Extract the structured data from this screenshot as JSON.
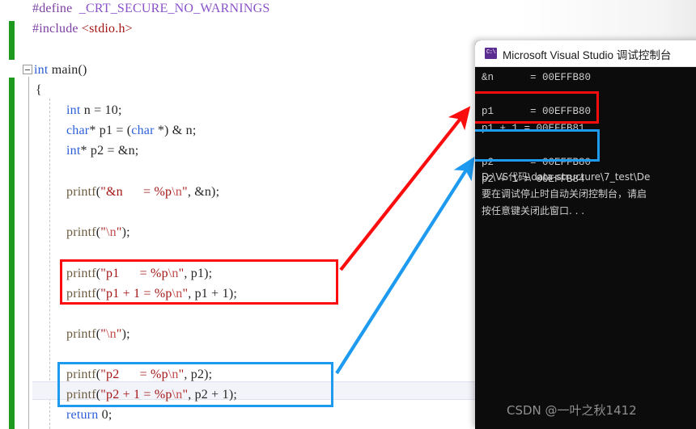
{
  "editor": {
    "code_lines": [
      {
        "indent": 0,
        "tokens": [
          {
            "t": "#define  ",
            "c": "k-pre"
          },
          {
            "t": "_CRT_SECURE_NO_WARNINGS",
            "c": "k-macro"
          }
        ]
      },
      {
        "indent": 0,
        "tokens": [
          {
            "t": "#include ",
            "c": "k-pre"
          },
          {
            "t": "<stdio.h>",
            "c": "k-str"
          }
        ]
      },
      {
        "indent": 0,
        "tokens": [
          {
            "t": "",
            "c": "k-plain"
          }
        ]
      },
      {
        "indent": 0,
        "tokens": [
          {
            "t": "int",
            "c": "k-type"
          },
          {
            "t": " main()",
            "c": "k-plain"
          }
        ]
      },
      {
        "indent": 0,
        "tokens": [
          {
            "t": "{",
            "c": "k-plain"
          }
        ]
      },
      {
        "indent": 0,
        "tokens": [
          {
            "t": "int",
            "c": "k-type"
          },
          {
            "t": " n = ",
            "c": "k-plain"
          },
          {
            "t": "10",
            "c": "k-num"
          },
          {
            "t": ";",
            "c": "k-plain"
          }
        ]
      },
      {
        "indent": 0,
        "tokens": [
          {
            "t": "char",
            "c": "k-type"
          },
          {
            "t": "* p1 = (",
            "c": "k-plain"
          },
          {
            "t": "char",
            "c": "k-type"
          },
          {
            "t": " *) & n;",
            "c": "k-plain"
          }
        ]
      },
      {
        "indent": 0,
        "tokens": [
          {
            "t": "int",
            "c": "k-type"
          },
          {
            "t": "* p2 = &n;",
            "c": "k-plain"
          }
        ]
      },
      {
        "indent": 0,
        "tokens": [
          {
            "t": "",
            "c": "k-plain"
          }
        ]
      },
      {
        "indent": 0,
        "tokens": [
          {
            "t": "printf",
            "c": "k-fn"
          },
          {
            "t": "(",
            "c": "k-plain"
          },
          {
            "t": "\"&n      = %p",
            "c": "k-str"
          },
          {
            "t": "\\n",
            "c": "k-esc"
          },
          {
            "t": "\"",
            "c": "k-str"
          },
          {
            "t": ", &n);",
            "c": "k-plain"
          }
        ]
      },
      {
        "indent": 0,
        "tokens": [
          {
            "t": "",
            "c": "k-plain"
          }
        ]
      },
      {
        "indent": 0,
        "tokens": [
          {
            "t": "printf",
            "c": "k-fn"
          },
          {
            "t": "(",
            "c": "k-plain"
          },
          {
            "t": "\"",
            "c": "k-str"
          },
          {
            "t": "\\n",
            "c": "k-esc"
          },
          {
            "t": "\"",
            "c": "k-str"
          },
          {
            "t": ");",
            "c": "k-plain"
          }
        ]
      },
      {
        "indent": 0,
        "tokens": [
          {
            "t": "",
            "c": "k-plain"
          }
        ]
      },
      {
        "indent": 0,
        "tokens": [
          {
            "t": "printf",
            "c": "k-fn"
          },
          {
            "t": "(",
            "c": "k-plain"
          },
          {
            "t": "\"p1      = %p",
            "c": "k-str"
          },
          {
            "t": "\\n",
            "c": "k-esc"
          },
          {
            "t": "\"",
            "c": "k-str"
          },
          {
            "t": ", p1);",
            "c": "k-plain"
          }
        ]
      },
      {
        "indent": 0,
        "tokens": [
          {
            "t": "printf",
            "c": "k-fn"
          },
          {
            "t": "(",
            "c": "k-plain"
          },
          {
            "t": "\"p1 + 1 = %p",
            "c": "k-str"
          },
          {
            "t": "\\n",
            "c": "k-esc"
          },
          {
            "t": "\"",
            "c": "k-str"
          },
          {
            "t": ", p1 + ",
            "c": "k-plain"
          },
          {
            "t": "1",
            "c": "k-num"
          },
          {
            "t": ");",
            "c": "k-plain"
          }
        ]
      },
      {
        "indent": 0,
        "tokens": [
          {
            "t": "",
            "c": "k-plain"
          }
        ]
      },
      {
        "indent": 0,
        "tokens": [
          {
            "t": "printf",
            "c": "k-fn"
          },
          {
            "t": "(",
            "c": "k-plain"
          },
          {
            "t": "\"",
            "c": "k-str"
          },
          {
            "t": "\\n",
            "c": "k-esc"
          },
          {
            "t": "\"",
            "c": "k-str"
          },
          {
            "t": ");",
            "c": "k-plain"
          }
        ]
      },
      {
        "indent": 0,
        "tokens": [
          {
            "t": "",
            "c": "k-plain"
          }
        ]
      },
      {
        "indent": 0,
        "tokens": [
          {
            "t": "printf",
            "c": "k-fn"
          },
          {
            "t": "(",
            "c": "k-plain"
          },
          {
            "t": "\"p2      = %p",
            "c": "k-str"
          },
          {
            "t": "\\n",
            "c": "k-esc"
          },
          {
            "t": "\"",
            "c": "k-str"
          },
          {
            "t": ", p2);",
            "c": "k-plain"
          }
        ]
      },
      {
        "indent": 0,
        "tokens": [
          {
            "t": "printf",
            "c": "k-fn"
          },
          {
            "t": "(",
            "c": "k-plain"
          },
          {
            "t": "\"p2 + 1 = %p",
            "c": "k-str"
          },
          {
            "t": "\\n",
            "c": "k-esc"
          },
          {
            "t": "\"",
            "c": "k-str"
          },
          {
            "t": ", p2 + ",
            "c": "k-plain"
          },
          {
            "t": "1",
            "c": "k-num"
          },
          {
            "t": ");",
            "c": "k-plain"
          }
        ]
      },
      {
        "indent": 0,
        "tokens": [
          {
            "t": "return",
            "c": "k-type"
          },
          {
            "t": " ",
            "c": "k-plain"
          },
          {
            "t": "0",
            "c": "k-num"
          },
          {
            "t": ";",
            "c": "k-plain"
          }
        ]
      }
    ],
    "collapse_symbol": "−",
    "annotation_boxes": [
      {
        "name": "code-highlight-p1",
        "color": "#fb0d0d"
      },
      {
        "name": "code-highlight-p2",
        "color": "#1e9bf0"
      }
    ]
  },
  "console": {
    "title": "Microsoft Visual Studio 调试控制台",
    "icon_glyph": "C:\\",
    "output_lines": [
      "&n      = 00EFFB80",
      "",
      "p1      = 00EFFB80",
      "p1 + 1 = 00EFFB81",
      "",
      "p2      = 00EFFB80",
      "p2 + 1 = 00EFFB84",
      ""
    ],
    "footer_lines": [
      "D:\\VS代码\\data-structure\\7_test\\De",
      "要在调试停止时自动关闭控制台，请启",
      "按任意键关闭此窗口. . ."
    ],
    "annotation_boxes": [
      {
        "name": "console-highlight-p1",
        "color": "#fb0d0d"
      },
      {
        "name": "console-highlight-p2",
        "color": "#1e9bf0"
      }
    ]
  },
  "arrows": [
    {
      "name": "red-arrow",
      "color": "#fb0d0d",
      "from": "code-p1-box",
      "to": "console-p1-box"
    },
    {
      "name": "blue-arrow",
      "color": "#1e9bf0",
      "from": "code-p2-box",
      "to": "console-p2-box"
    }
  ],
  "watermark": {
    "text": "CSDN @一叶之秋1412"
  }
}
